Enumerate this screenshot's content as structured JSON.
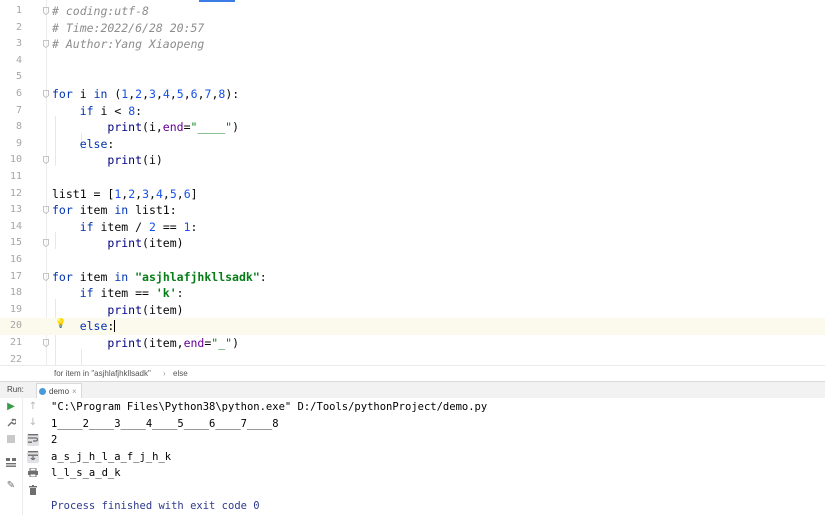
{
  "editor": {
    "lines": [
      {
        "n": "1",
        "tokens": [
          {
            "t": "# coding:utf-8",
            "c": "cmt"
          }
        ],
        "fold": true
      },
      {
        "n": "2",
        "tokens": [
          {
            "t": "# Time:2022/6/28 20:57",
            "c": "cmt"
          }
        ]
      },
      {
        "n": "3",
        "tokens": [
          {
            "t": "# Author:Yang Xiaopeng",
            "c": "cmt"
          }
        ],
        "fold": true
      },
      {
        "n": "4",
        "tokens": []
      },
      {
        "n": "5",
        "tokens": []
      },
      {
        "n": "6",
        "tokens": [
          {
            "t": "for",
            "c": "kw"
          },
          {
            "t": " i "
          },
          {
            "t": "in",
            "c": "kw"
          },
          {
            "t": " ("
          },
          {
            "t": "1",
            "c": "num"
          },
          {
            "t": ","
          },
          {
            "t": "2",
            "c": "num"
          },
          {
            "t": ","
          },
          {
            "t": "3",
            "c": "num"
          },
          {
            "t": ","
          },
          {
            "t": "4",
            "c": "num"
          },
          {
            "t": ","
          },
          {
            "t": "5",
            "c": "num"
          },
          {
            "t": ","
          },
          {
            "t": "6",
            "c": "num"
          },
          {
            "t": ","
          },
          {
            "t": "7",
            "c": "num"
          },
          {
            "t": ","
          },
          {
            "t": "8",
            "c": "num"
          },
          {
            "t": "):"
          }
        ],
        "fold": true
      },
      {
        "n": "7",
        "tokens": [
          {
            "t": "    "
          },
          {
            "t": "if",
            "c": "kw"
          },
          {
            "t": " i < "
          },
          {
            "t": "8",
            "c": "num"
          },
          {
            "t": ":"
          }
        ]
      },
      {
        "n": "8",
        "tokens": [
          {
            "t": "        "
          },
          {
            "t": "print",
            "c": "fn"
          },
          {
            "t": "(i,"
          },
          {
            "t": "end",
            "c": "prm"
          },
          {
            "t": "="
          },
          {
            "t": "\"____\"",
            "c": "str"
          },
          {
            "t": ")"
          }
        ]
      },
      {
        "n": "9",
        "tokens": [
          {
            "t": "    "
          },
          {
            "t": "else",
            "c": "kw"
          },
          {
            "t": ":"
          }
        ]
      },
      {
        "n": "10",
        "tokens": [
          {
            "t": "        "
          },
          {
            "t": "print",
            "c": "fn"
          },
          {
            "t": "(i)"
          }
        ],
        "fold": true
      },
      {
        "n": "11",
        "tokens": []
      },
      {
        "n": "12",
        "tokens": [
          {
            "t": "list1 = ["
          },
          {
            "t": "1",
            "c": "num"
          },
          {
            "t": ","
          },
          {
            "t": "2",
            "c": "num"
          },
          {
            "t": ","
          },
          {
            "t": "3",
            "c": "num"
          },
          {
            "t": ","
          },
          {
            "t": "4",
            "c": "num"
          },
          {
            "t": ","
          },
          {
            "t": "5",
            "c": "num"
          },
          {
            "t": ","
          },
          {
            "t": "6",
            "c": "num"
          },
          {
            "t": "]"
          }
        ]
      },
      {
        "n": "13",
        "tokens": [
          {
            "t": "for",
            "c": "kw"
          },
          {
            "t": " item "
          },
          {
            "t": "in",
            "c": "kw"
          },
          {
            "t": " list1:"
          }
        ],
        "fold": true
      },
      {
        "n": "14",
        "tokens": [
          {
            "t": "    "
          },
          {
            "t": "if",
            "c": "kw"
          },
          {
            "t": " item / "
          },
          {
            "t": "2",
            "c": "num"
          },
          {
            "t": " == "
          },
          {
            "t": "1",
            "c": "num"
          },
          {
            "t": ":"
          }
        ]
      },
      {
        "n": "15",
        "tokens": [
          {
            "t": "        "
          },
          {
            "t": "print",
            "c": "fn"
          },
          {
            "t": "(item)"
          }
        ],
        "fold": true
      },
      {
        "n": "16",
        "tokens": []
      },
      {
        "n": "17",
        "tokens": [
          {
            "t": "for",
            "c": "kw"
          },
          {
            "t": " item "
          },
          {
            "t": "in",
            "c": "kw"
          },
          {
            "t": " "
          },
          {
            "t": "\"asjhlafjhkllsadk\"",
            "c": "strb"
          },
          {
            "t": ":"
          }
        ],
        "fold": true
      },
      {
        "n": "18",
        "tokens": [
          {
            "t": "    "
          },
          {
            "t": "if",
            "c": "kw"
          },
          {
            "t": " item == "
          },
          {
            "t": "'k'",
            "c": "strb"
          },
          {
            "t": ":"
          }
        ]
      },
      {
        "n": "19",
        "tokens": [
          {
            "t": "        "
          },
          {
            "t": "print",
            "c": "fn"
          },
          {
            "t": "(item)"
          }
        ]
      },
      {
        "n": "20",
        "tokens": [
          {
            "t": "    "
          },
          {
            "t": "else",
            "c": "kw"
          },
          {
            "t": ":"
          }
        ],
        "current": true,
        "bulb": true
      },
      {
        "n": "21",
        "tokens": [
          {
            "t": "        "
          },
          {
            "t": "print",
            "c": "fn"
          },
          {
            "t": "(item,"
          },
          {
            "t": "end",
            "c": "prm"
          },
          {
            "t": "="
          },
          {
            "t": "\"_\"",
            "c": "str"
          },
          {
            "t": ")"
          }
        ],
        "fold": true
      },
      {
        "n": "22",
        "tokens": []
      }
    ]
  },
  "breadcrumb": {
    "item1": "for item in \"asjhlafjhkllsadk\"",
    "separator": "›",
    "item2": "else"
  },
  "run_panel": {
    "label": "Run:",
    "tab_name": "demo",
    "tab_close": "×"
  },
  "console": {
    "lines": [
      {
        "text": "\"C:\\Program Files\\Python38\\python.exe\" D:/Tools/pythonProject/demo.py",
        "cls": "cmd"
      },
      {
        "text": "1____2____3____4____5____6____7____8",
        "cls": "cmd"
      },
      {
        "text": "2",
        "cls": "cmd"
      },
      {
        "text": "a_s_j_h_l_a_f_j_h_k",
        "cls": "cmd"
      },
      {
        "text": "l_l_s_a_d_k",
        "cls": "cmd"
      },
      {
        "text": "",
        "cls": "cmd"
      },
      {
        "text": "Process finished with exit code 0",
        "cls": "fin"
      }
    ]
  },
  "toolbar_icons": [
    "run-icon",
    "wrench-icon",
    "stop-icon",
    "layout-icon",
    "pin-icon",
    "up-arrow-icon",
    "down-arrow-icon",
    "soft-wrap-icon",
    "scroll-to-end-icon",
    "print-icon",
    "trash-icon"
  ],
  "colors": {
    "keyword": "#0033b3",
    "number": "#1750eb",
    "string": "#067d17",
    "comment": "#8c8c8c",
    "current_line": "#fcfaed",
    "run_icon": "#3a9b46"
  }
}
